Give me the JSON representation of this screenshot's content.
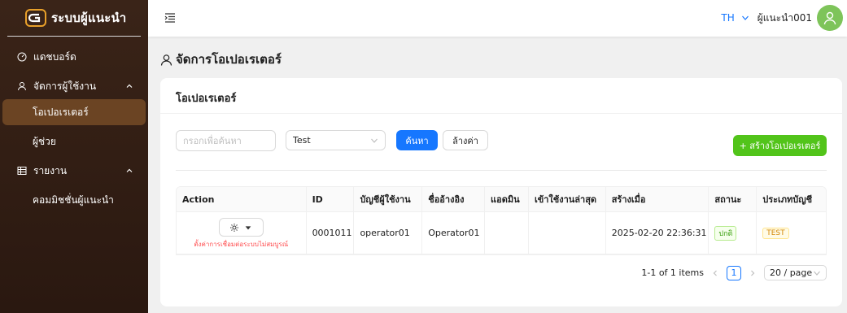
{
  "brand": {
    "title": "ระบบผู้แนะนำ"
  },
  "sidebar": {
    "items": [
      {
        "label": "แดชบอร์ด",
        "icon": "dashboard-icon"
      },
      {
        "label": "จัดการผู้ใช้งาน",
        "icon": "user-icon",
        "expanded": true
      },
      {
        "label": "โอเปอเรเตอร์",
        "active": true
      },
      {
        "label": "ผู้ช่วย"
      },
      {
        "label": "รายงาน",
        "icon": "table-icon",
        "expanded": true
      },
      {
        "label": "คอมมิชชั่นผู้แนะนำ"
      }
    ]
  },
  "header": {
    "lang": "TH",
    "username": "ผู้แนะนำ001"
  },
  "page": {
    "title": "จัดการโอเปอเรเตอร์"
  },
  "card": {
    "title": "โอเปอเรเตอร์",
    "search_placeholder": "กรอกเพื่อค้นหา",
    "select_value": "Test",
    "search_button": "ค้นหา",
    "clear_button": "ล้างค่า",
    "create_button": "+ สร้างโอเปอเรเตอร์"
  },
  "table": {
    "columns": [
      "Action",
      "ID",
      "บัญชีผู้ใช้งาน",
      "ชื่ออ้างอิง",
      "แอดมิน",
      "เข้าใช้งานล่าสุด",
      "สร้างเมื่อ",
      "สถานะ",
      "ประเภทบัญชี"
    ],
    "rows": [
      {
        "note": "ตั้งค่าการเชื่อมต่อระบบไม่สมบูรณ์",
        "id": "0001011",
        "account": "operator01",
        "ref_name": "Operator01",
        "admin": "",
        "last_login": "",
        "created": "2025-02-20 22:36:31",
        "status": "ปกติ",
        "account_type": "TEST"
      }
    ]
  },
  "pagination": {
    "summary": "1-1 of 1 items",
    "current": "1",
    "page_size": "20 / page"
  },
  "colors": {
    "accent": "#1677ff",
    "create": "#52c41a",
    "sidebar_active": "#6b4423",
    "avatar": "#7ec45a"
  }
}
